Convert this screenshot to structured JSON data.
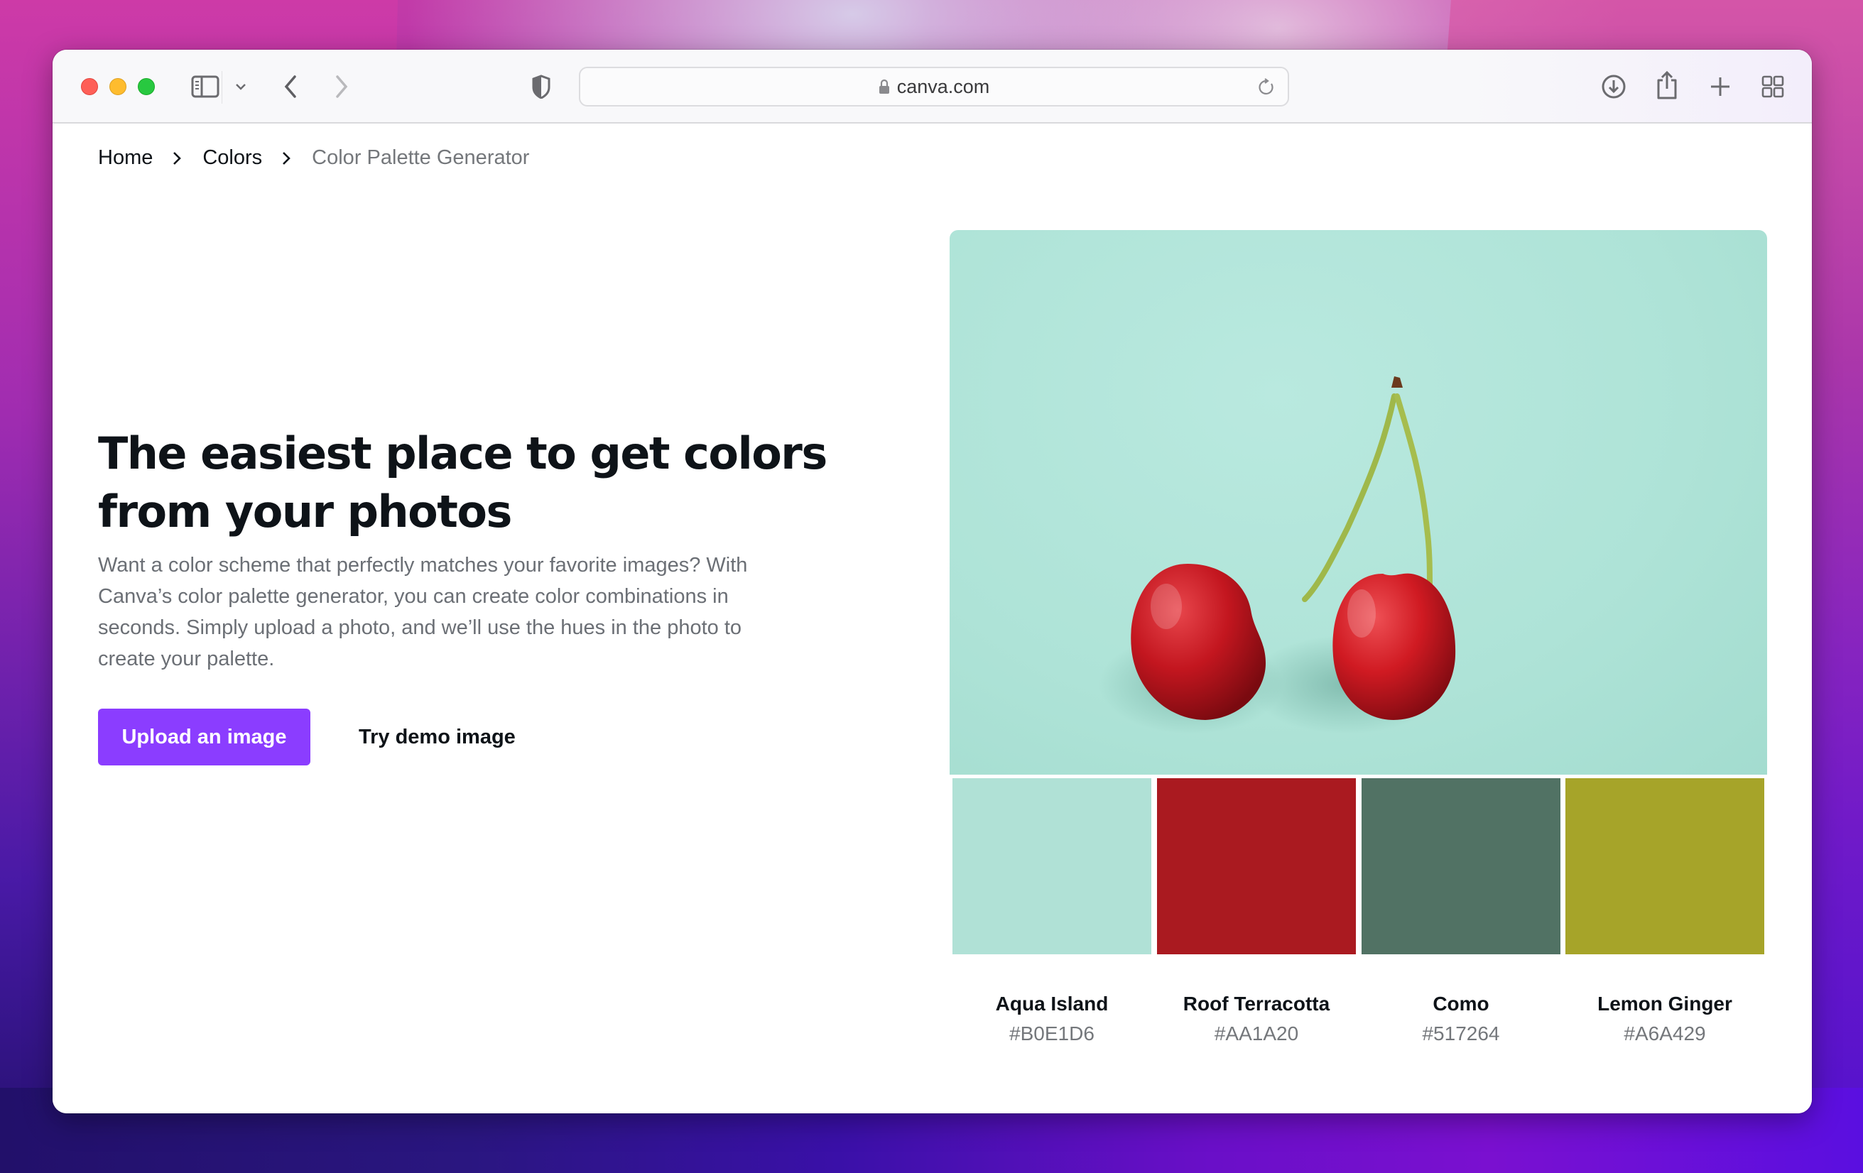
{
  "browser": {
    "url": "canva.com",
    "icons": [
      "sidebar-icon",
      "chevron-down-icon",
      "back-arrow-icon",
      "forward-arrow-icon",
      "shield-icon",
      "lock-icon",
      "reload-icon",
      "download-icon",
      "share-icon",
      "plus-icon",
      "tab-grid-icon"
    ]
  },
  "breadcrumb": {
    "items": [
      {
        "label": "Home"
      },
      {
        "label": "Colors"
      },
      {
        "label": "Color Palette Generator"
      }
    ]
  },
  "hero": {
    "title": "The easiest place to get colors from your photos",
    "description": "Want a color scheme that perfectly matches your favorite images? With Canva’s color palette generator, you can create color combinations in seconds. Simply upload a photo, and we’ll use the hues in the photo to create your palette.",
    "upload_button": "Upload an image",
    "demo_button": "Try demo image",
    "accent_color": "#8B3DFF"
  },
  "photo": {
    "subject": "two red cherries on a mint background"
  },
  "palette": [
    {
      "name": "Aqua Island",
      "hex": "#B0E1D6"
    },
    {
      "name": "Roof Terracotta",
      "hex": "#AA1A20"
    },
    {
      "name": "Como",
      "hex": "#517264"
    },
    {
      "name": "Lemon Ginger",
      "hex": "#A6A429"
    }
  ]
}
